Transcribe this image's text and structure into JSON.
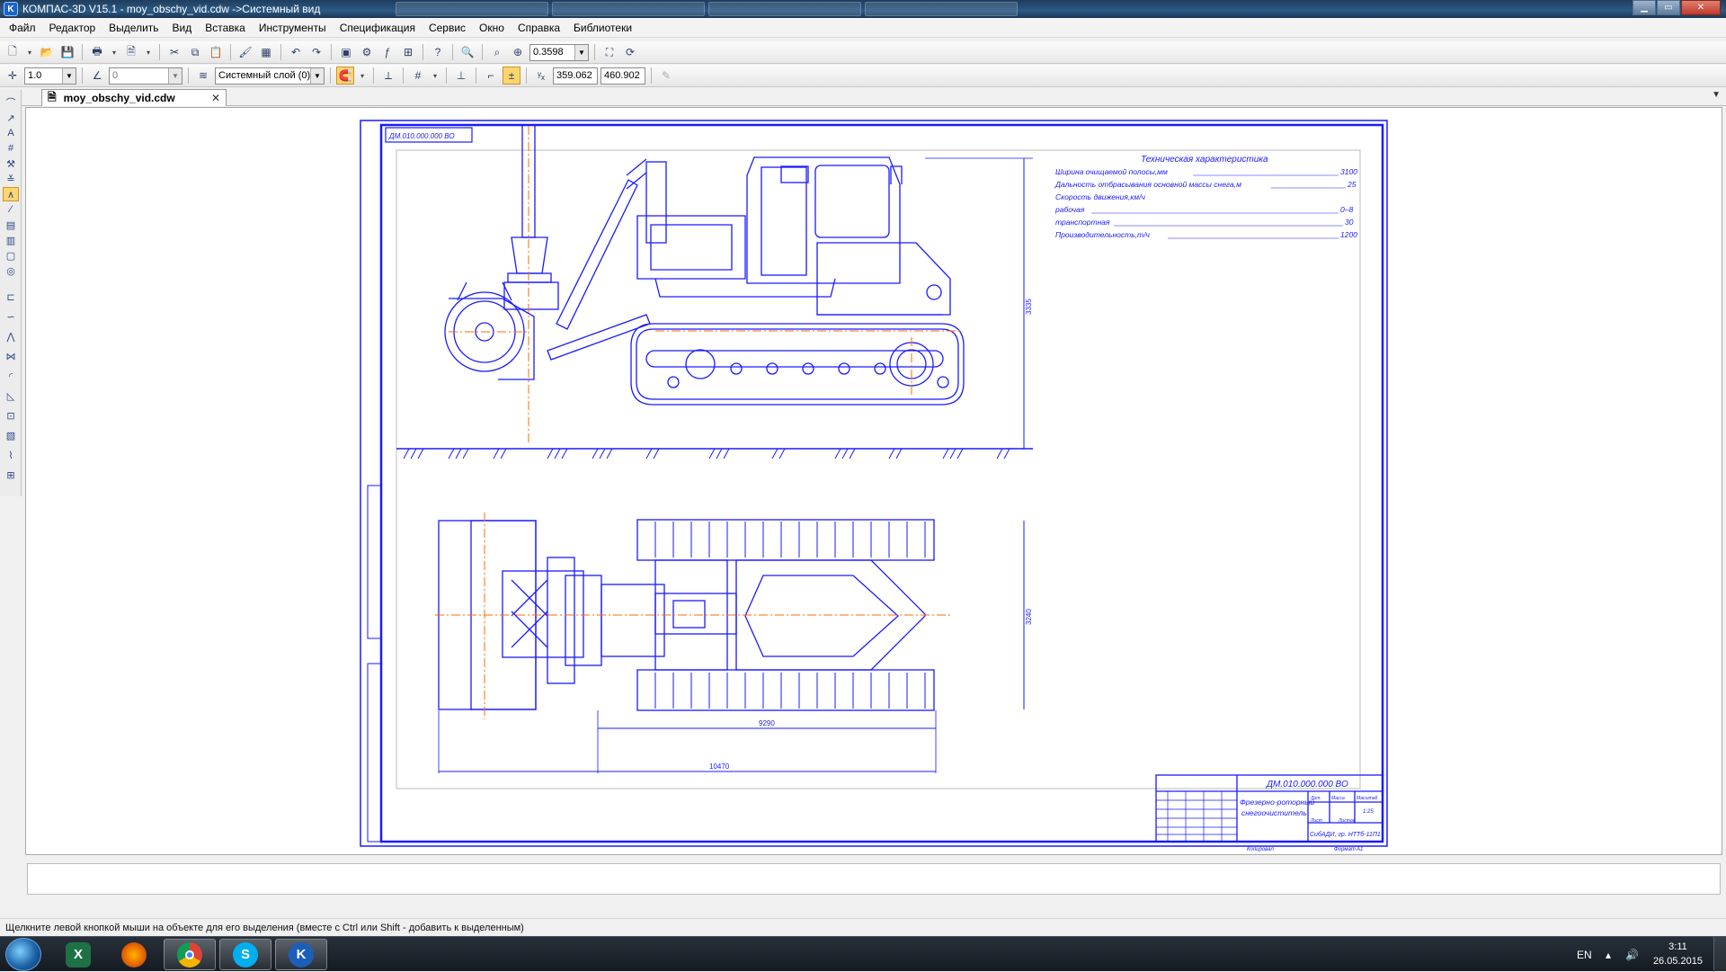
{
  "window": {
    "title": "КОМПАС-3D V15.1 - moy_obschy_vid.cdw ->Системный вид",
    "app_icon": "kompas-icon",
    "buttons": {
      "minimize": "▁",
      "maximize": "▭",
      "close": "✕"
    }
  },
  "menu": [
    "Файл",
    "Редактор",
    "Выделить",
    "Вид",
    "Вставка",
    "Инструменты",
    "Спецификация",
    "Сервис",
    "Окно",
    "Справка",
    "Библиотеки"
  ],
  "toolbar": {
    "zoom_value": "0.3598",
    "step_value": "1.0",
    "angle_value": "0",
    "layer_value": "Системный слой (0)",
    "coord_x": "359.062",
    "coord_y": "460.902"
  },
  "document_tab": {
    "label": "moy_obschy_vid.cdw",
    "close": "✕"
  },
  "drawing": {
    "stamp_box": "ДМ.010.000.000 ВО",
    "tech_title": "Техническая характеристика",
    "tech_rows": [
      {
        "label": "Ширина очищаемой полосы,мм",
        "value": "3100"
      },
      {
        "label": "Дальность отбрасывания основной массы снега,м",
        "value": "25"
      },
      {
        "label": "Скорость движения,км/ч",
        "value": ""
      },
      {
        "label": "рабочая",
        "value": "0–8"
      },
      {
        "label": "транспортная",
        "value": "30"
      },
      {
        "label": "Производительность,т/ч",
        "value": "1200"
      }
    ],
    "dim_side_height": "3335",
    "dim_plan_width": "3240",
    "dim_plan_length": "9290",
    "dim_plan_total": "10470",
    "title_block": {
      "doc_code": "ДМ.010.000.000 ВО",
      "name_line1": "Фрезерно-роторный",
      "name_line2": "снегоочиститель",
      "org": "СибАДИ, гр. НТТб-11П1",
      "lit": "Лит.",
      "mass": "Масса",
      "scale": "Масштаб",
      "scale_value": "1:25",
      "sheet": "Лист",
      "sheets": "Листов",
      "copied": "Копировал",
      "format": "Формат",
      "format_value": "A1"
    }
  },
  "status": {
    "message": "Щелкните левой кнопкой мыши на объекте для его выделения (вместе с Ctrl или Shift - добавить к выделенным)"
  },
  "taskbar": {
    "apps": [
      {
        "name": "excel",
        "letter": "X",
        "color": "#1e7145"
      },
      {
        "name": "firefox",
        "letter": "",
        "color": "#e66000"
      },
      {
        "name": "chrome",
        "letter": "",
        "color": "#db4437"
      },
      {
        "name": "skype",
        "letter": "S",
        "color": "#00aff0"
      },
      {
        "name": "kompas",
        "letter": "K",
        "color": "#1c5fb8"
      }
    ],
    "lang": "EN",
    "time": "3:11",
    "date": "26.05.2015"
  }
}
